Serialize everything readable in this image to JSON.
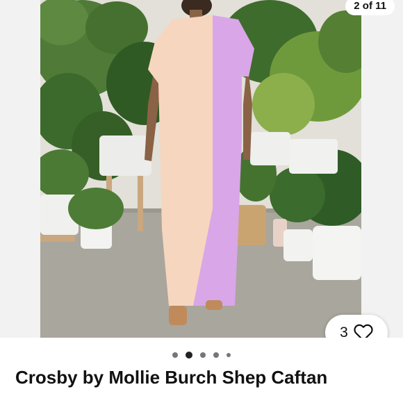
{
  "gallery": {
    "counter": "2 of 11",
    "image_alt": "Woman in pink and purple color-block caftan among potted plants",
    "pager": {
      "total_dots": 5,
      "active_index": 1
    }
  },
  "watch": {
    "count": "3",
    "icon": "heart-icon"
  },
  "listing": {
    "title": "Crosby by Mollie Burch Shep Caftan"
  },
  "colors": {
    "dress_peach": "#f6d6bf",
    "dress_lilac": "#d9a6e8",
    "plant_green": "#3f6b2f",
    "floor": "#a9a69d"
  }
}
